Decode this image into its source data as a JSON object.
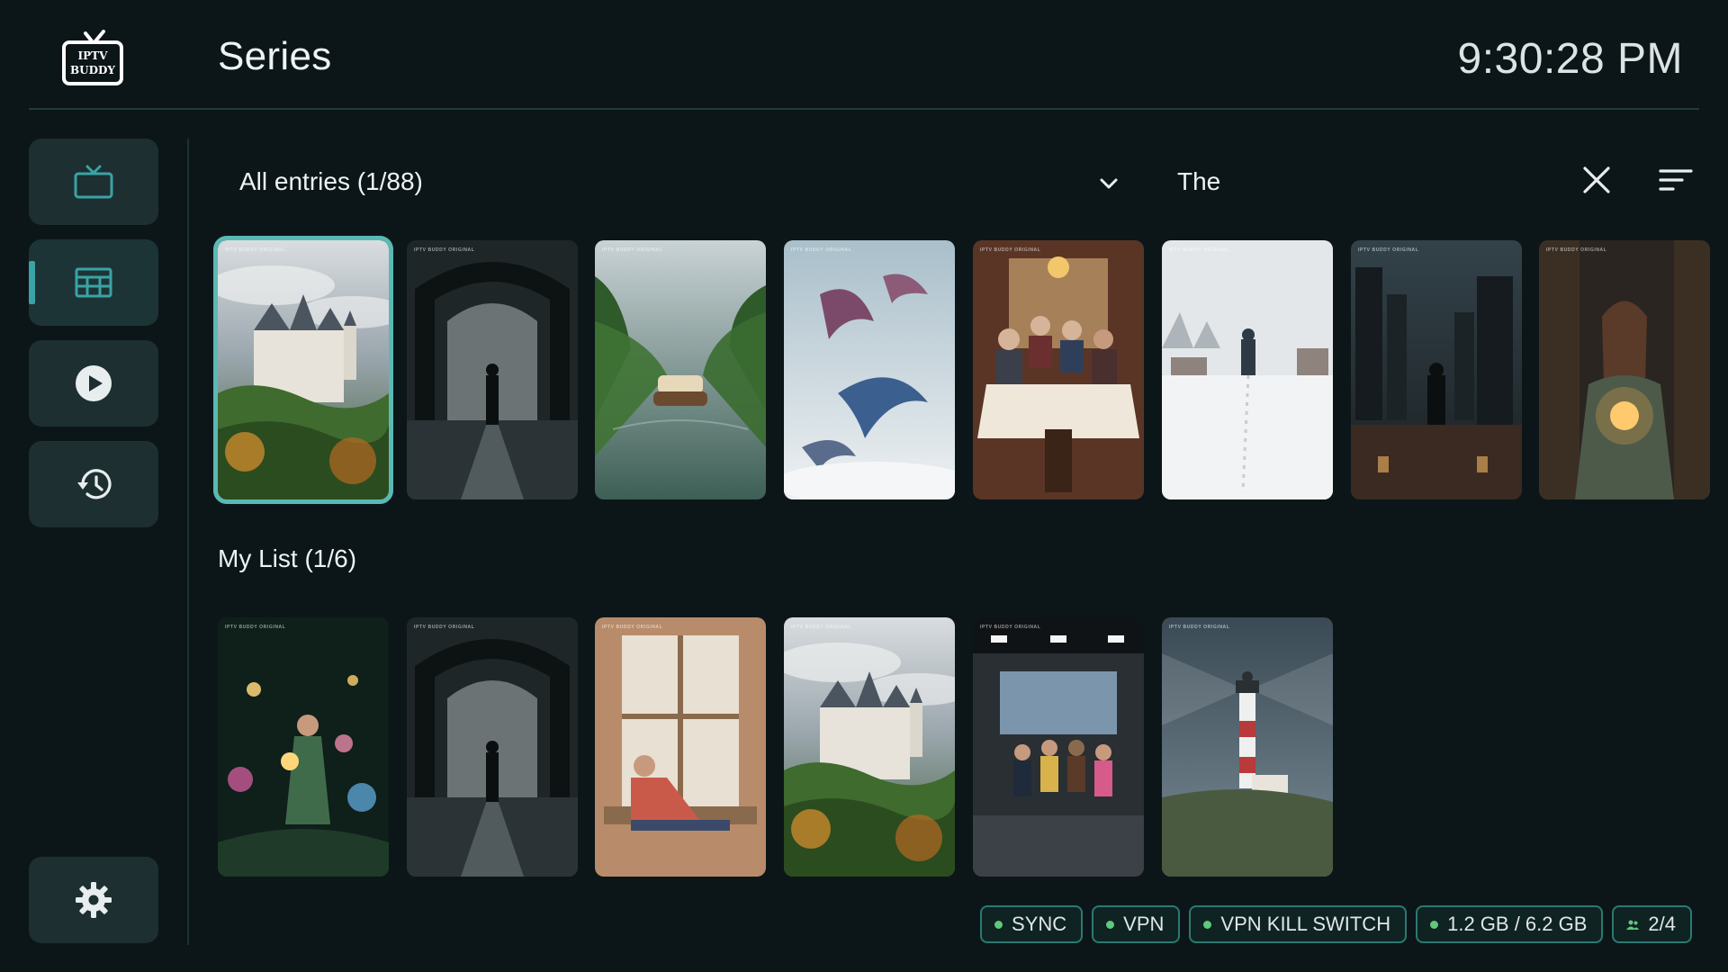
{
  "header": {
    "logo_text_line1": "IPTV",
    "logo_text_line2": "BUDDY",
    "title": "Series",
    "clock": "9:30:28 PM"
  },
  "sidebar": {
    "items": [
      {
        "name": "live-tv",
        "icon": "tv-icon",
        "active": false
      },
      {
        "name": "series",
        "icon": "grid-icon",
        "active": true
      },
      {
        "name": "movies",
        "icon": "play-icon",
        "active": false
      },
      {
        "name": "history",
        "icon": "history-icon",
        "active": false
      }
    ],
    "settings_icon": "gear-icon"
  },
  "filter": {
    "label": "All entries (1/88)",
    "search_value": "The"
  },
  "posters_tag": "IPTV BUDDY ORIGINAL",
  "all_entries": [
    {
      "scene": "castle",
      "selected": true
    },
    {
      "scene": "bridge",
      "selected": false
    },
    {
      "scene": "river",
      "selected": false
    },
    {
      "scene": "birds",
      "selected": false
    },
    {
      "scene": "dinner",
      "selected": false
    },
    {
      "scene": "snow",
      "selected": false
    },
    {
      "scene": "city",
      "selected": false
    },
    {
      "scene": "library",
      "selected": false
    }
  ],
  "my_list": {
    "label": "My List (1/6)",
    "items": [
      {
        "scene": "garden"
      },
      {
        "scene": "bridge"
      },
      {
        "scene": "window"
      },
      {
        "scene": "castle"
      },
      {
        "scene": "studio"
      },
      {
        "scene": "lighthouse"
      }
    ]
  },
  "status": {
    "sync": "SYNC",
    "vpn": "VPN",
    "kill_switch": "VPN KILL SWITCH",
    "storage": "1.2 GB / 6.2 GB",
    "connections": "2/4"
  },
  "colors": {
    "accent": "#3aa3a5",
    "selection": "#5bb9b4",
    "status_dot": "#5ec97a",
    "background": "#0c1618"
  }
}
